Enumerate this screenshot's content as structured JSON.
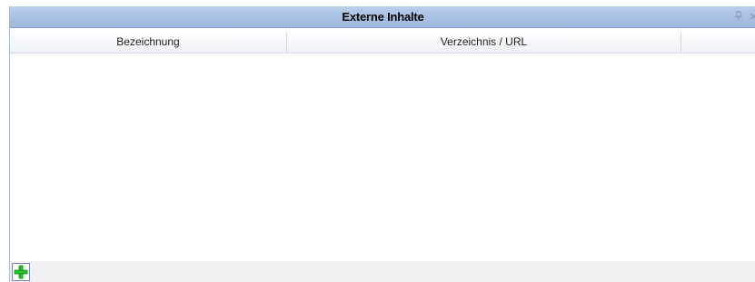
{
  "panel": {
    "title": "Externe Inhalte",
    "pin_icon": "pin-icon",
    "close_icon": "close-icon"
  },
  "grid": {
    "columns": [
      "Bezeichnung",
      "Verzeichnis / URL",
      ""
    ],
    "rows": []
  },
  "footer": {
    "add_icon": "add-plus-icon",
    "add_icon_color": "#22c322"
  },
  "colors": {
    "titlebar": "#a7c1e2",
    "header_bg": "#f5f7fa",
    "footer_bg": "#f0f0f0"
  }
}
